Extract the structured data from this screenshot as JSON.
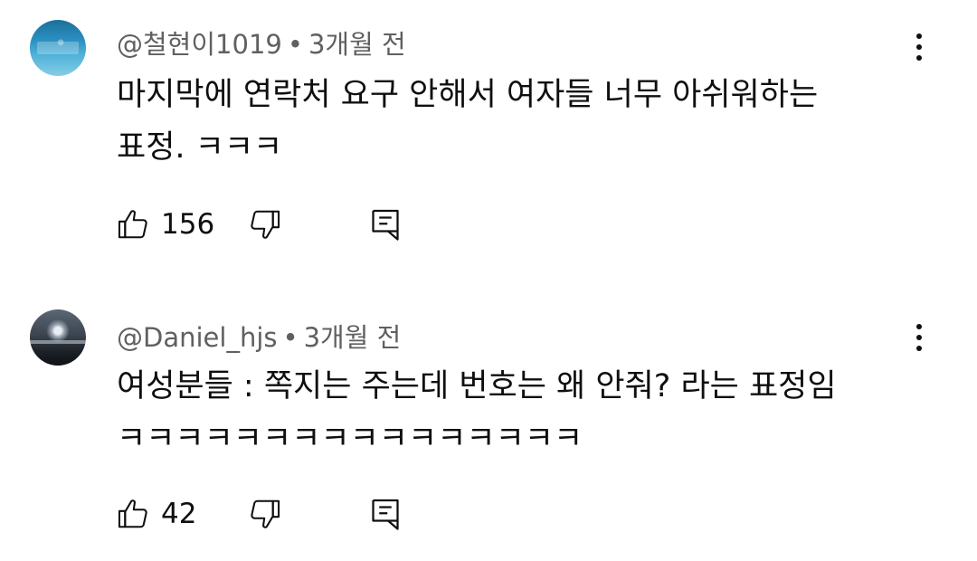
{
  "comments": [
    {
      "author": "@철현이1019",
      "separator": "•",
      "time": "3개월 전",
      "lines": [
        "마지막에 연락처 요구 안해서 여자들 너무 아쉬워하는",
        "표정. ㅋㅋㅋ"
      ],
      "likes": "156"
    },
    {
      "author": "@Daniel_hjs",
      "separator": "•",
      "time": "3개월 전",
      "lines": [
        "여성분들 : 쪽지는 주는데 번호는 왜 안줘? 라는 표정임",
        "ㅋㅋㅋㅋㅋㅋㅋㅋㅋㅋㅋㅋㅋㅋㅋㅋ"
      ],
      "likes": "42"
    }
  ],
  "icons": {
    "like": "thumb-up-outline",
    "dislike": "thumb-down-outline",
    "reply": "comment-outline",
    "menu": "more-vertical"
  },
  "colors": {
    "text": "#0f0f0f",
    "meta": "#606060",
    "background": "#ffffff"
  }
}
